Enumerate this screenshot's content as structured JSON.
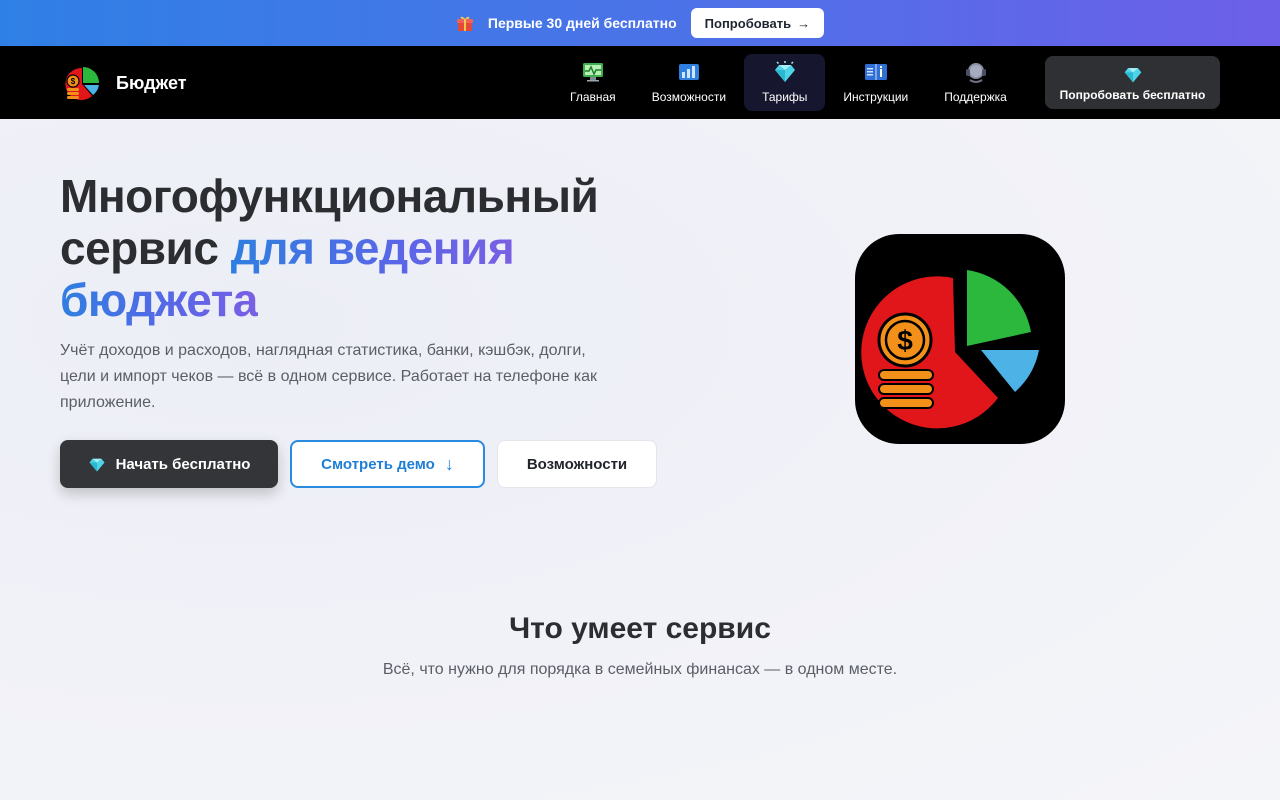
{
  "promo": {
    "text": "Первые 30 дней бесплатно",
    "button_label": "Попробовать",
    "button_arrow": "→",
    "icon": "gift-icon"
  },
  "nav": {
    "brand": "Бюджет",
    "items": [
      {
        "label": "Главная",
        "icon": "monitor-chart-icon"
      },
      {
        "label": "Возможности",
        "icon": "bar-chart-icon"
      },
      {
        "label": "Тарифы",
        "icon": "diamond-icon",
        "active": true
      },
      {
        "label": "Инструкции",
        "icon": "book-icon"
      },
      {
        "label": "Поддержка",
        "icon": "headset-icon"
      }
    ],
    "cta_label": "Попробовать бесплатно"
  },
  "hero": {
    "title_line1": "Многофункциональный",
    "title_line2_plain": "сервис ",
    "title_line2_accent": "для ведения",
    "title_line3_accent": "бюджета",
    "description": "Учёт доходов и расходов, наглядная статистика, банки, кэшбэк, долги, цели и импорт чеков — всё в одном сервисе. Работает на телефоне как приложение.",
    "btn_primary": "Начать бесплатно",
    "btn_demo": "Смотреть демо",
    "btn_demo_arrow": "↓",
    "btn_features": "Возможности"
  },
  "features": {
    "title": "Что умеет сервис",
    "subtitle": "Всё, что нужно для порядка в семейных финансах — в одном месте."
  },
  "colors": {
    "accent_blue": "#2f7fe0",
    "accent_purple": "#6d5fe8",
    "nav_bg": "#000000",
    "pie_red": "#e0161b",
    "pie_green": "#2bb83c",
    "pie_blue": "#4db3e6",
    "coin_orange": "#f39019"
  }
}
